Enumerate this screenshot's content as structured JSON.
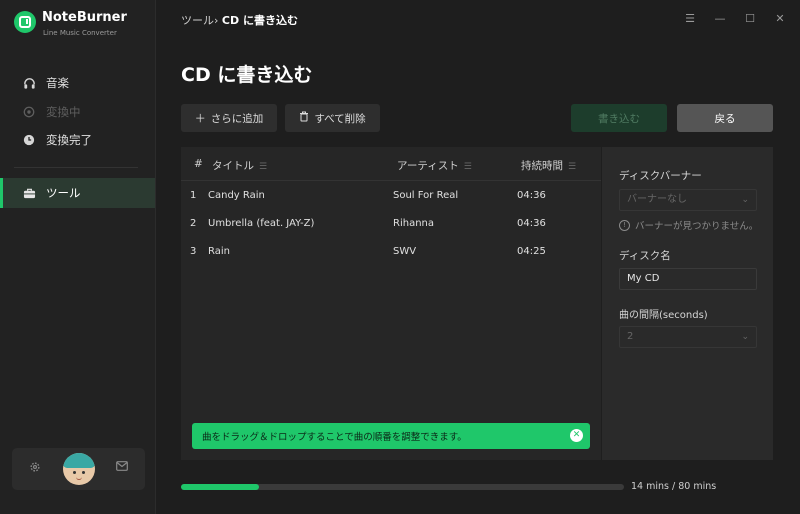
{
  "app": {
    "name": "NoteBurner",
    "subtitle": "Line Music Converter",
    "accent": "#1fc76a"
  },
  "sidebar": {
    "items": [
      {
        "label": "音楽",
        "icon": "headphones-icon",
        "state": "normal"
      },
      {
        "label": "変換中",
        "icon": "converting-icon",
        "state": "disabled"
      },
      {
        "label": "変換完了",
        "icon": "clock-icon",
        "state": "normal"
      },
      {
        "label": "ツール",
        "icon": "toolbox-icon",
        "state": "active"
      }
    ]
  },
  "breadcrumb": {
    "parent": "ツール",
    "separator": "›",
    "current": "CD に書き込む"
  },
  "window_controls": [
    "menu-icon",
    "minimize-icon",
    "maximize-icon",
    "close-icon"
  ],
  "page": {
    "title": "CD に書き込む"
  },
  "toolbar": {
    "add_label": "さらに追加",
    "clear_label": "すべて削除",
    "burn_label": "書き込む",
    "back_label": "戻る"
  },
  "table": {
    "headers": {
      "num": "#",
      "title": "タイトル",
      "artist": "アーティスト",
      "duration": "持続時間"
    },
    "rows": [
      {
        "num": "1",
        "title": "Candy Rain",
        "artist": "Soul For Real",
        "duration": "04:36"
      },
      {
        "num": "2",
        "title": "Umbrella (feat. JAY-Z)",
        "artist": "Rihanna",
        "duration": "04:36"
      },
      {
        "num": "3",
        "title": "Rain",
        "artist": "SWV",
        "duration": "04:25"
      }
    ]
  },
  "toast": {
    "message": "曲をドラッグ＆ドロップすることで曲の順番を調整できます。"
  },
  "settings": {
    "disc_banner_label": "ディスクバーナー",
    "disc_banner_value": "バーナーなし",
    "disc_banner_info": "バーナーが見つかりません。",
    "disc_name_label": "ディスク名",
    "disc_name_value": "My CD",
    "gap_label": "曲の間隔(seconds)",
    "gap_value": "2"
  },
  "progress": {
    "fraction": 0.175,
    "text": "14 mins / 80 mins"
  }
}
